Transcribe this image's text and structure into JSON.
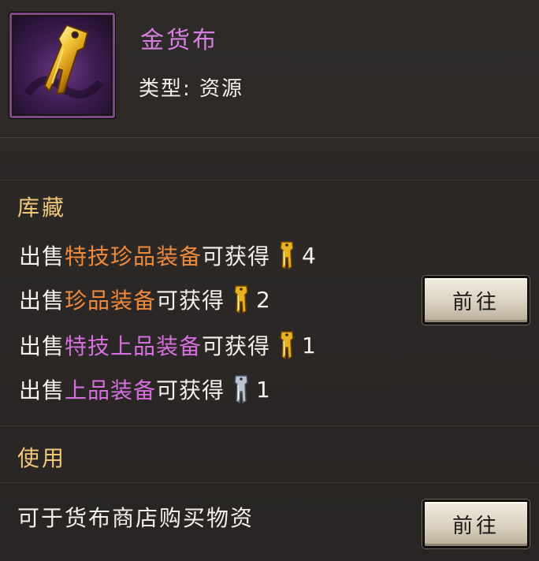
{
  "item": {
    "name": "金货布",
    "type_label": "类型: 资源",
    "colors": {
      "name": "#d77fe0",
      "frame": "#7e4a86"
    },
    "icon": "gold-coin-icon"
  },
  "storage": {
    "title": "库藏",
    "goto_label": "前往",
    "rows": [
      {
        "prefix": "出售",
        "item": "特技珍品装备",
        "item_color": "orange",
        "suffix": "可获得",
        "coin": "gold-coin-icon",
        "count": "4"
      },
      {
        "prefix": "出售",
        "item": "珍品装备",
        "item_color": "orange",
        "suffix": "可获得",
        "coin": "gold-coin-icon",
        "count": "2"
      },
      {
        "prefix": "出售",
        "item": "特技上品装备",
        "item_color": "purple",
        "suffix": "可获得",
        "coin": "gold-coin-icon",
        "count": "1"
      },
      {
        "prefix": "出售",
        "item": "上品装备",
        "item_color": "purple",
        "suffix": "可获得",
        "coin": "silver-coin-icon",
        "count": "1"
      }
    ]
  },
  "use": {
    "title": "使用",
    "description": "可于货布商店购买物资",
    "goto_label": "前往"
  },
  "colors": {
    "section_title": "#f0c77a",
    "orange": "#f08a3a",
    "purple": "#d46fdc",
    "gold_coin": "#e0a21c",
    "silver_coin": "#b8c4d0"
  }
}
